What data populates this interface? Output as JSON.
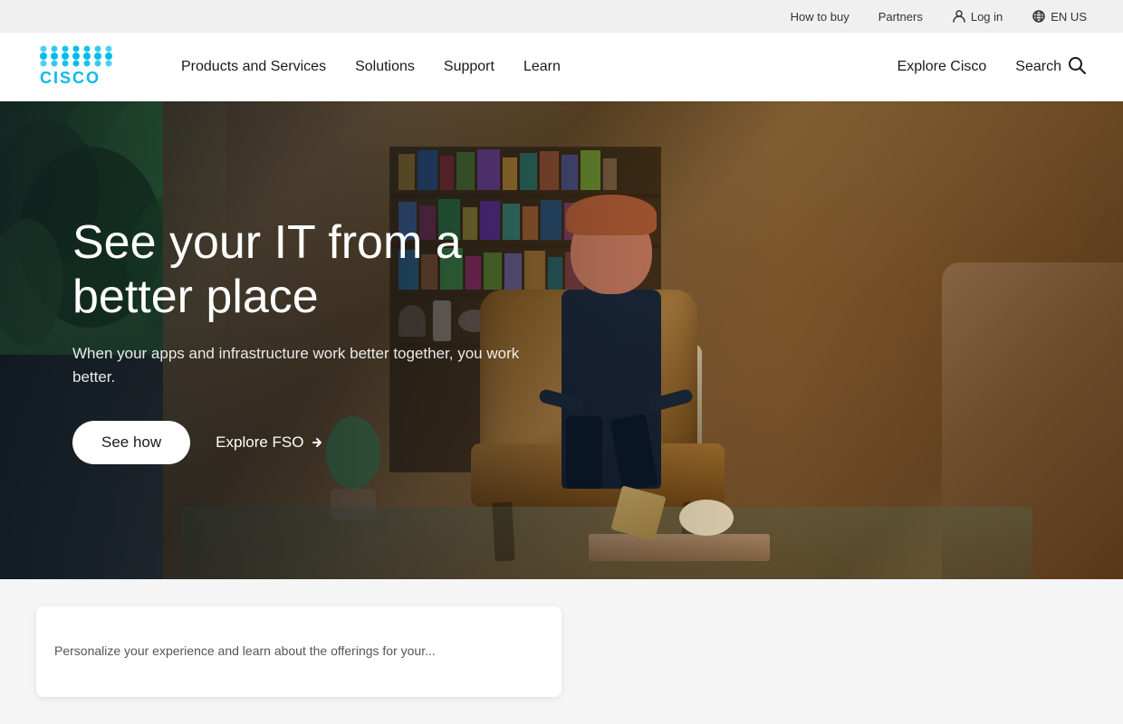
{
  "utility_bar": {
    "how_to_buy": "How to buy",
    "partners": "Partners",
    "log_in": "Log in",
    "language": "EN US"
  },
  "nav": {
    "logo_alt": "Cisco",
    "products_label": "Products and Services",
    "solutions_label": "Solutions",
    "support_label": "Support",
    "learn_label": "Learn",
    "explore_cisco_label": "Explore Cisco",
    "search_label": "Search"
  },
  "hero": {
    "title": "See your IT from a better place",
    "subtitle": "When your apps and infrastructure work better together, you work better.",
    "cta_primary": "See how",
    "cta_secondary": "Explore FSO"
  },
  "below_hero": {
    "card_text": "Personalize your experience and learn about the offerings for your..."
  },
  "colors": {
    "cisco_blue": "#00bceb",
    "nav_bg": "#ffffff",
    "utility_bg": "#f0f0f0",
    "hero_text": "#ffffff"
  }
}
